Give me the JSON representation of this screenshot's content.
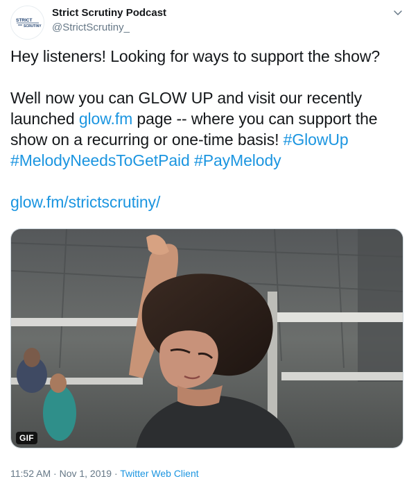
{
  "tweet": {
    "author": {
      "name": "Strict Scrutiny Podcast",
      "handle": "@StrictScrutiny_",
      "avatar_logo_text": "STRICT SCRUTINY"
    },
    "menu_icon": "chevron-down-icon",
    "text": {
      "line1": "Hey listeners!  Looking for ways to support the show?",
      "p2_part1": "Well now you can GLOW UP and visit our recently launched ",
      "p2_link": "glow.fm",
      "p2_part2": " page -- where you can support the show on a recurring or one-time basis! ",
      "hashtag_1": "#GlowUp",
      "hashtag_2": "#MelodyNeedsToGetPaid",
      "hashtag_3": "#PayMelody",
      "url": "glow.fm/strictscrutiny/"
    },
    "media": {
      "badge": "GIF"
    },
    "meta": {
      "time": "11:52 AM",
      "separator": " · ",
      "date": "Nov 1, 2019",
      "client": "Twitter Web Client"
    },
    "colors": {
      "link": "#1b95e0",
      "muted": "#657786",
      "text": "#14171a"
    }
  }
}
